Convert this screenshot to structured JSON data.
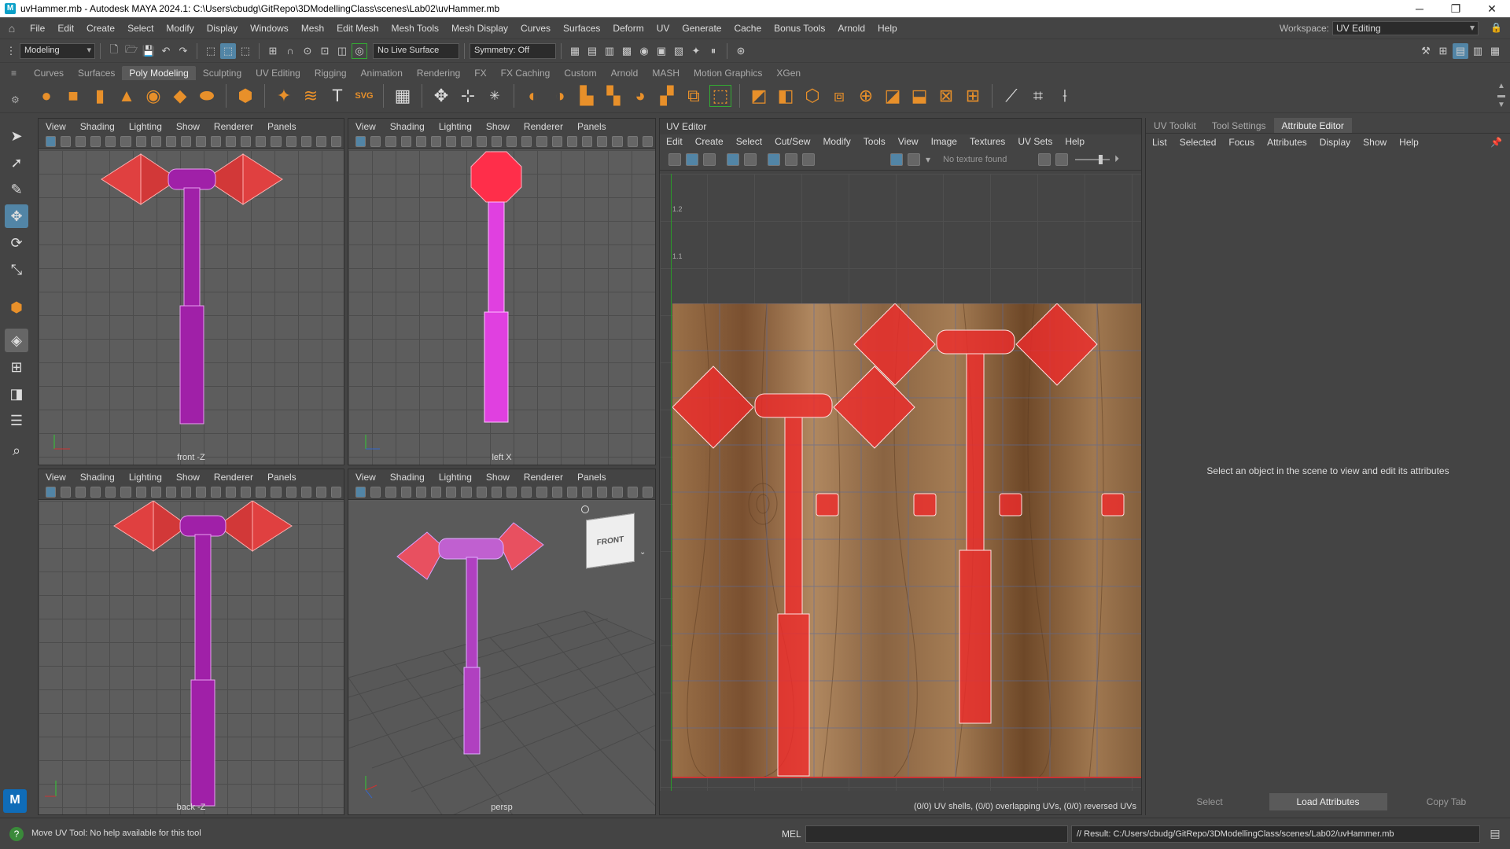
{
  "window": {
    "title": "uvHammer.mb - Autodesk MAYA 2024.1: C:\\Users\\cbudg\\GitRepo\\3DModellingClass\\scenes\\Lab02\\uvHammer.mb",
    "minimize": "─",
    "maximize": "❐",
    "close": "✕"
  },
  "menubar": {
    "items": [
      "File",
      "Edit",
      "Create",
      "Select",
      "Modify",
      "Display",
      "Windows",
      "Mesh",
      "Edit Mesh",
      "Mesh Tools",
      "Mesh Display",
      "Curves",
      "Surfaces",
      "Deform",
      "UV",
      "Generate",
      "Cache",
      "Bonus Tools",
      "Arnold",
      "Help"
    ],
    "workspace_label": "Workspace:",
    "workspace_value": "UV Editing"
  },
  "statusline": {
    "mode": "Modeling",
    "live_surface": "No Live Surface",
    "symmetry": "Symmetry: Off"
  },
  "shelf": {
    "tabs": [
      "Curves",
      "Surfaces",
      "Poly Modeling",
      "Sculpting",
      "UV Editing",
      "Rigging",
      "Animation",
      "Rendering",
      "FX",
      "FX Caching",
      "Custom",
      "Arnold",
      "MASH",
      "Motion Graphics",
      "XGen"
    ],
    "active_tab": "Poly Modeling"
  },
  "viewport_menu": [
    "View",
    "Shading",
    "Lighting",
    "Show",
    "Renderer",
    "Panels"
  ],
  "viewports": {
    "top_left": "front -Z",
    "top_right": "left X",
    "bottom_left": "back -Z",
    "bottom_right": "persp"
  },
  "viewcube_label": "FRONT",
  "uv_editor": {
    "title": "UV Editor",
    "menus": [
      "Edit",
      "Create",
      "Select",
      "Cut/Sew",
      "Modify",
      "Tools",
      "View",
      "Image",
      "Textures",
      "UV Sets",
      "Help"
    ],
    "texture_status": "No texture found",
    "ruler_labels": [
      "1.2",
      "1.1"
    ],
    "footer": "(0/0) UV shells, (0/0) overlapping UVs, (0/0) reversed UVs"
  },
  "attribute_editor": {
    "tabs": [
      "UV Toolkit",
      "Tool Settings",
      "Attribute Editor"
    ],
    "active_tab": "Attribute Editor",
    "menus": [
      "List",
      "Selected",
      "Focus",
      "Attributes",
      "Display",
      "Show",
      "Help"
    ],
    "message": "Select an object in the scene to view and edit its attributes",
    "buttons": [
      "Select",
      "Load Attributes",
      "Copy Tab"
    ]
  },
  "helpline": {
    "text": "Move UV Tool: No help available for this tool",
    "mel_label": "MEL",
    "result": "// Result: C:/Users/cbudg/GitRepo/3DModellingClass/scenes/Lab02/uvHammer.mb"
  },
  "logo": "M",
  "colors": {
    "accent": "#5285a6",
    "hammer_handle": "#a020a8",
    "hammer_head": "#e04040",
    "uv_shell": "#f02a2a",
    "wood": "#8a6442"
  }
}
